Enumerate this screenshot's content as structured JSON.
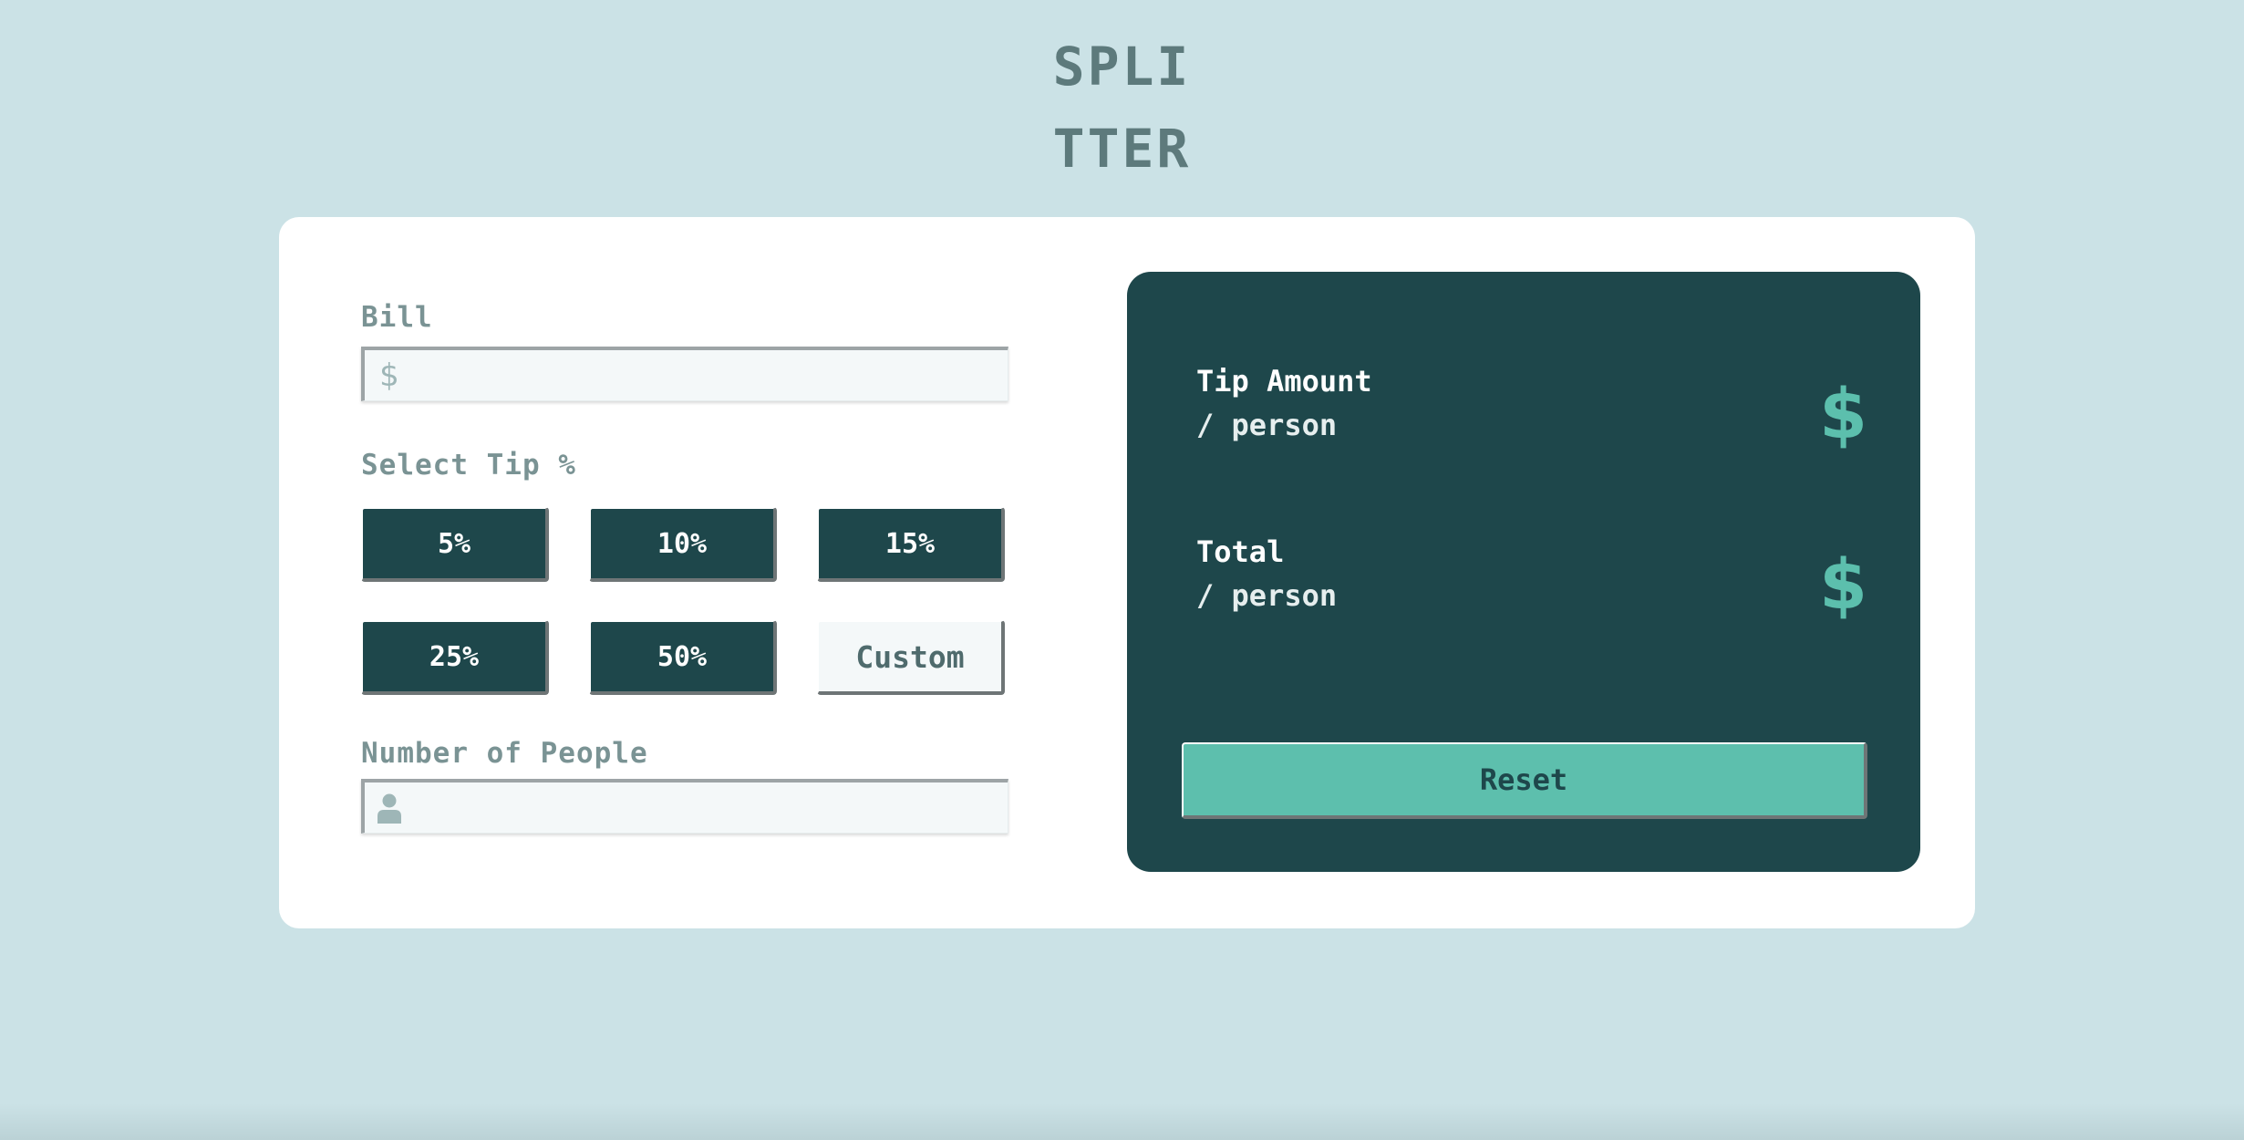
{
  "app": {
    "logo_line1": "SPLI",
    "logo_line2": "TTER"
  },
  "form": {
    "bill": {
      "label": "Bill",
      "icon": "dollar-icon",
      "icon_glyph": "$",
      "value": ""
    },
    "tip": {
      "label": "Select Tip %",
      "options": [
        {
          "label": "5%"
        },
        {
          "label": "10%"
        },
        {
          "label": "15%"
        },
        {
          "label": "25%"
        },
        {
          "label": "50%"
        }
      ],
      "custom_label": "Custom"
    },
    "people": {
      "label": "Number of People",
      "icon": "person-icon",
      "value": ""
    }
  },
  "results": {
    "tip_amount": {
      "title": "Tip Amount",
      "sub": "/ person",
      "value": "$"
    },
    "total": {
      "title": "Total",
      "sub": "/ person",
      "value": "$"
    },
    "reset_label": "Reset"
  },
  "colors": {
    "background": "#cbe2e6",
    "card": "#ffffff",
    "dark_teal": "#1e474b",
    "accent": "#5cbfad",
    "label_grey": "#7a9394"
  }
}
